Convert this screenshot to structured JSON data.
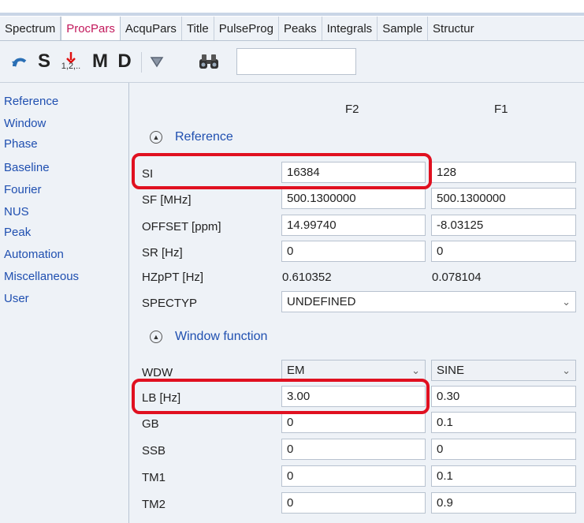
{
  "tabs": [
    "Spectrum",
    "ProcPars",
    "AcquPars",
    "Title",
    "PulseProg",
    "Peaks",
    "Integrals",
    "Sample",
    "Structur"
  ],
  "active_tab": "ProcPars",
  "toolbar": {
    "s_label": "S",
    "m_label": "M",
    "d_label": "D",
    "numbering_label": "1,2,..",
    "search_value": ""
  },
  "sidebar": {
    "items": [
      "Reference",
      "Window",
      "Phase",
      "Baseline",
      "Fourier",
      "NUS",
      "Peak",
      "Automation",
      "Miscellaneous",
      "User"
    ]
  },
  "columns": {
    "f2": "F2",
    "f1": "F1"
  },
  "sections": {
    "reference": "Reference",
    "window": "Window function"
  },
  "params": {
    "si": {
      "label": "SI",
      "f2": "16384",
      "f1": "128"
    },
    "sf": {
      "label": "SF [MHz]",
      "f2": "500.1300000",
      "f1": "500.1300000"
    },
    "offset": {
      "label": "OFFSET [ppm]",
      "f2": "14.99740",
      "f1": "-8.03125"
    },
    "sr": {
      "label": "SR [Hz]",
      "f2": "0",
      "f1": "0"
    },
    "hzppt": {
      "label": "HZpPT [Hz]",
      "f2": "0.610352",
      "f1": "0.078104"
    },
    "spectyp": {
      "label": "SPECTYP",
      "value": "UNDEFINED"
    },
    "wdw": {
      "label": "WDW",
      "f2": "EM",
      "f1": "SINE"
    },
    "lb": {
      "label": "LB [Hz]",
      "f2": "3.00",
      "f1": "0.30"
    },
    "gb": {
      "label": "GB",
      "f2": "0",
      "f1": "0.1"
    },
    "ssb": {
      "label": "SSB",
      "f2": "0",
      "f1": "0"
    },
    "tm1": {
      "label": "TM1",
      "f2": "0",
      "f1": "0.1"
    },
    "tm2": {
      "label": "TM2",
      "f2": "0",
      "f1": "0.9"
    }
  },
  "colors": {
    "highlight": "#e01020",
    "active_tab": "#c2185b",
    "link": "#1f4fb0"
  }
}
